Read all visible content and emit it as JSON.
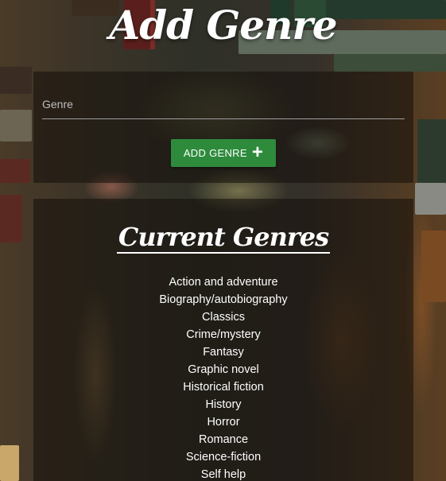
{
  "page_title": "Add Genre",
  "form": {
    "input_placeholder": "Genre",
    "input_value": "",
    "add_button_label": "ADD GENRE",
    "add_button_icon": "+"
  },
  "genres": {
    "heading": "Current Genres",
    "items": [
      "Action and adventure",
      "Biography/autobiography",
      "Classics",
      "Crime/mystery",
      "Fantasy",
      "Graphic novel",
      "Historical fiction",
      "History",
      "Horror",
      "Romance",
      "Science-fiction",
      "Self help"
    ]
  },
  "colors": {
    "accent": "#2e8b3c",
    "panel_background": "rgba(20,14,10,0.55)",
    "text": "#ffffff"
  }
}
